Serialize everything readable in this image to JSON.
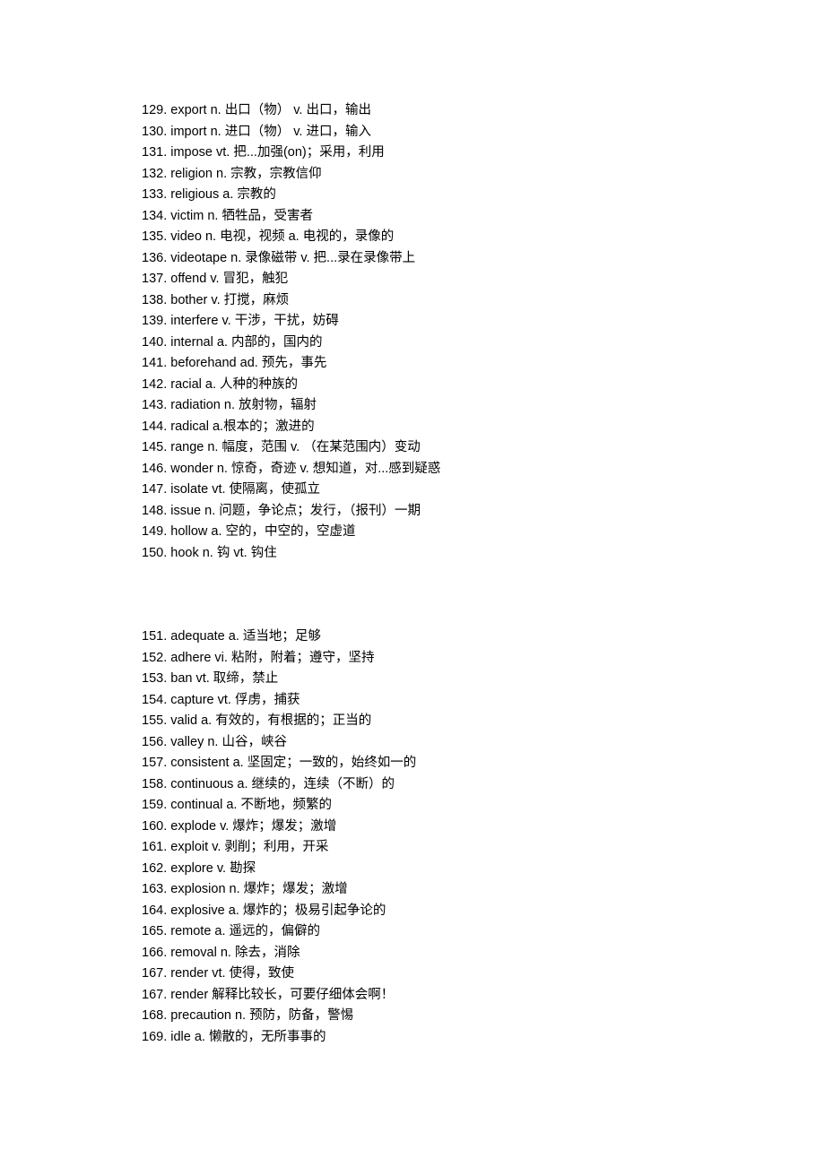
{
  "group1": [
    {
      "num": "129.",
      "word": "export n.",
      "def": " 出口（物） v. 出口，输出"
    },
    {
      "num": "130.",
      "word": "import n.",
      "def": " 进口（物） v. 进口，输入"
    },
    {
      "num": "131.",
      "word": "impose vt.",
      "def": " 把...加强(on)；采用，利用"
    },
    {
      "num": "132.",
      "word": "religion n.",
      "def": " 宗教，宗教信仰"
    },
    {
      "num": "133.",
      "word": "religious a.",
      "def": " 宗教的"
    },
    {
      "num": "134.",
      "word": "victim n.",
      "def": " 牺牲品，受害者"
    },
    {
      "num": "135.",
      "word": "video n.",
      "def": " 电视，视频 a. 电视的，录像的"
    },
    {
      "num": "136.",
      "word": "videotape n.",
      "def": " 录像磁带 v. 把...录在录像带上"
    },
    {
      "num": "137.",
      "word": "offend v.",
      "def": " 冒犯，触犯"
    },
    {
      "num": "138.",
      "word": "bother v.",
      "def": " 打搅，麻烦"
    },
    {
      "num": "139.",
      "word": "interfere v.",
      "def": " 干涉，干扰，妨碍"
    },
    {
      "num": "140.",
      "word": "internal a.",
      "def": " 内部的，国内的"
    },
    {
      "num": "141.",
      "word": "beforehand ad.",
      "def": " 预先，事先"
    },
    {
      "num": "142.",
      "word": "racial a.",
      "def": " 人种的种族的"
    },
    {
      "num": "143.",
      "word": "radiation n.",
      "def": " 放射物，辐射"
    },
    {
      "num": "144.",
      "word": "radical a.",
      "def": "根本的；激进的"
    },
    {
      "num": "145.",
      "word": "range n.",
      "def": " 幅度，范围 v. （在某范围内）变动"
    },
    {
      "num": "146.",
      "word": "wonder n.",
      "def": " 惊奇，奇迹 v. 想知道，对...感到疑惑"
    },
    {
      "num": "147.",
      "word": "isolate vt.",
      "def": " 使隔离，使孤立"
    },
    {
      "num": "148.",
      "word": "issue n.",
      "def": " 问题，争论点；发行，（报刊）一期"
    },
    {
      "num": "149.",
      "word": "hollow a.",
      "def": " 空的，中空的，空虚道"
    },
    {
      "num": "150.",
      "word": "hook n.",
      "def": " 钩 vt. 钩住"
    }
  ],
  "group2": [
    {
      "num": "151.",
      "word": "adequate a.",
      "def": " 适当地；足够"
    },
    {
      "num": "152.",
      "word": "adhere vi.",
      "def": " 粘附，附着；遵守，坚持"
    },
    {
      "num": "153.",
      "word": "ban vt.",
      "def": " 取缔，禁止"
    },
    {
      "num": "154.",
      "word": "capture vt.",
      "def": " 俘虏，捕获"
    },
    {
      "num": "155.",
      "word": "valid a.",
      "def": " 有效的，有根据的；正当的"
    },
    {
      "num": "156.",
      "word": "valley n.",
      "def": " 山谷，峡谷"
    },
    {
      "num": "157.",
      "word": "consistent a.",
      "def": " 坚固定；一致的，始终如一的"
    },
    {
      "num": "158.",
      "word": "continuous a.",
      "def": " 继续的，连续（不断）的"
    },
    {
      "num": "159.",
      "word": "continual a.",
      "def": " 不断地，频繁的"
    },
    {
      "num": "160.",
      "word": "explode v.",
      "def": " 爆炸；爆发；激增"
    },
    {
      "num": "161.",
      "word": "exploit v.",
      "def": " 剥削；利用，开采"
    },
    {
      "num": "162.",
      "word": "explore v.",
      "def": " 勘探"
    },
    {
      "num": "163.",
      "word": "explosion n.",
      "def": " 爆炸；爆发；激增"
    },
    {
      "num": "164.",
      "word": "explosive a.",
      "def": " 爆炸的；极易引起争论的"
    },
    {
      "num": "165.",
      "word": "remote a.",
      "def": " 遥远的，偏僻的"
    },
    {
      "num": "166.",
      "word": "removal n.",
      "def": " 除去，消除"
    },
    {
      "num": "167.",
      "word": "render vt.",
      "def": " 使得，致使"
    },
    {
      "num": "167.",
      "word": "render",
      "def": " 解释比较长，可要仔细体会啊！"
    },
    {
      "num": "168.",
      "word": "precaution n.",
      "def": " 预防，防备，警惕"
    },
    {
      "num": "169.",
      "word": "idle a.",
      "def": " 懒散的，无所事事的"
    }
  ]
}
